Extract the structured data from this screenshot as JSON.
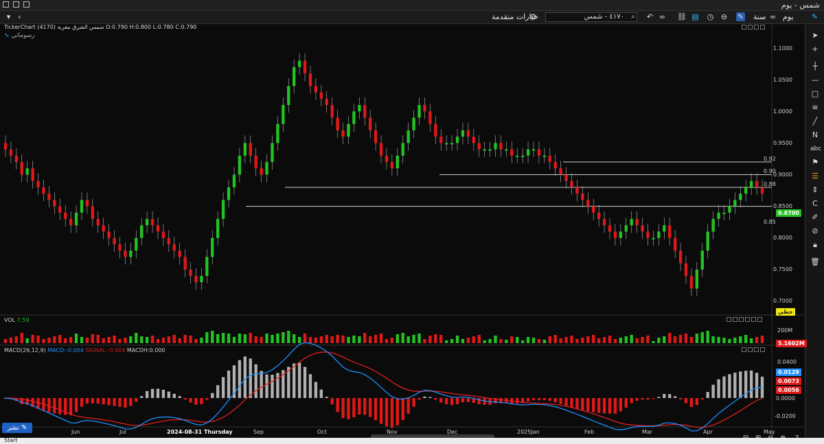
{
  "window": {
    "title": "شمس - يوم"
  },
  "toolbar": {
    "advanced_options": "خيارات متقدمة",
    "search_value": "٤١٧٠ - شمس",
    "period_year": "سنة",
    "period_day": "يوم"
  },
  "chart_header": {
    "info": "TickerChart (4170) شمس الشرق مغربة  O:0.790  H:0.800  L:0.780  C:0.790",
    "drawings_label": "رسوماتي"
  },
  "price_axis": {
    "ticks": [
      "1.1000",
      "1.0500",
      "1.0000",
      "0.9500",
      "0.9000",
      "0.8500",
      "0.8000",
      "0.7500",
      "0.7000"
    ],
    "current_price": "0.8700",
    "lines_label": "خطي"
  },
  "hlines": [
    {
      "label": "0.92",
      "value": 0.92
    },
    {
      "label": "0.90",
      "value": 0.9
    },
    {
      "label": "0.88",
      "value": 0.88
    },
    {
      "label": "0.85",
      "value": 0.85
    }
  ],
  "volume_pane": {
    "title": "VOL",
    "value": "7.59",
    "tick": "200M",
    "tag": "5.1602M"
  },
  "macd_pane": {
    "title": "MACD(26,12,9)",
    "macd": "MACD:-0.004",
    "signal": "SIGNAL:-0.004",
    "macdh": "MACDH:0.000",
    "ticks": [
      "0.0400",
      "0.0200",
      "0.0000",
      "-0.0200"
    ],
    "tag_macd": "0.0129",
    "tag_signal": "0.0073",
    "tag_hist": "0.0056"
  },
  "time_axis": {
    "labels": [
      "Jun",
      "Jul",
      "2024-08-31 Thursday",
      "Sep",
      "Oct",
      "Nov",
      "Dec",
      "2025Jan",
      "Feb",
      "Mar",
      "Apr",
      "May"
    ]
  },
  "bottom": {
    "publish": "نشر",
    "start": "Start"
  },
  "colors": {
    "up": "#22c322",
    "down": "#e01818",
    "bg": "#0b0b0b",
    "macd": "#1e90ff",
    "signal": "#e02020"
  },
  "chart_data": {
    "type": "candlestick",
    "closes": [
      0.94,
      0.93,
      0.92,
      0.9,
      0.91,
      0.89,
      0.88,
      0.87,
      0.86,
      0.85,
      0.84,
      0.83,
      0.82,
      0.84,
      0.86,
      0.85,
      0.83,
      0.82,
      0.81,
      0.8,
      0.79,
      0.78,
      0.77,
      0.78,
      0.8,
      0.82,
      0.83,
      0.82,
      0.81,
      0.8,
      0.79,
      0.78,
      0.77,
      0.75,
      0.74,
      0.73,
      0.74,
      0.77,
      0.8,
      0.83,
      0.86,
      0.88,
      0.9,
      0.93,
      0.95,
      0.93,
      0.91,
      0.9,
      0.92,
      0.95,
      0.98,
      1.01,
      1.04,
      1.07,
      1.08,
      1.06,
      1.04,
      1.03,
      1.02,
      1.01,
      0.99,
      0.97,
      0.96,
      0.98,
      1.0,
      1.01,
      0.99,
      0.97,
      0.95,
      0.93,
      0.92,
      0.91,
      0.93,
      0.95,
      0.97,
      0.99,
      1.01,
      1.0,
      0.98,
      0.96,
      0.95,
      0.95,
      0.95,
      0.96,
      0.97,
      0.96,
      0.95,
      0.94,
      0.94,
      0.94,
      0.95,
      0.94,
      0.94,
      0.93,
      0.93,
      0.93,
      0.94,
      0.94,
      0.93,
      0.93,
      0.92,
      0.91,
      0.9,
      0.89,
      0.88,
      0.87,
      0.86,
      0.85,
      0.84,
      0.83,
      0.82,
      0.81,
      0.8,
      0.81,
      0.82,
      0.83,
      0.82,
      0.81,
      0.8,
      0.8,
      0.81,
      0.82,
      0.8,
      0.78,
      0.76,
      0.74,
      0.72,
      0.75,
      0.78,
      0.81,
      0.83,
      0.84,
      0.84,
      0.85,
      0.86,
      0.87,
      0.88,
      0.89,
      0.88,
      0.87
    ]
  }
}
